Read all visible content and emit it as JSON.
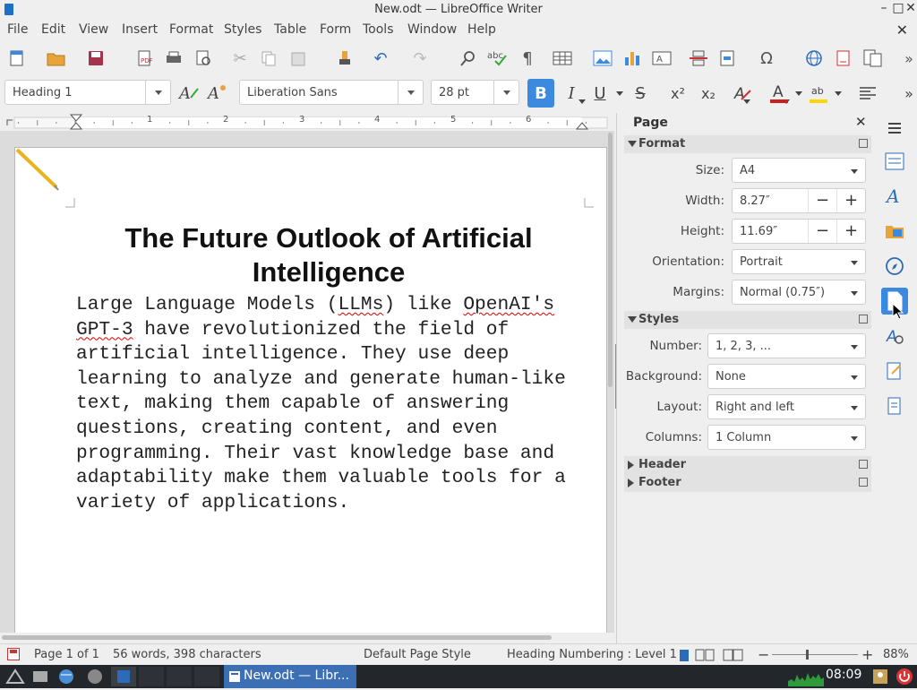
{
  "window": {
    "title": "New.odt — LibreOffice Writer"
  },
  "menu": [
    "File",
    "Edit",
    "View",
    "Insert",
    "Format",
    "Styles",
    "Table",
    "Form",
    "Tools",
    "Window",
    "Help"
  ],
  "format_bar": {
    "paragraph_style": "Heading 1",
    "font_name": "Liberation Sans",
    "font_size": "28 pt"
  },
  "document": {
    "heading": "The Future Outlook of Artificial Intelligence",
    "body": "Large Language Models (LLMs) like OpenAI's GPT-3 have revolutionized the field of artificial intelligence. They use deep learning to analyze and generate human-like text, making them capable of answering questions, creating content, and even programming. Their vast knowledge base and adaptability make them valuable tools for a variety of applications."
  },
  "ruler": {
    "marks": [
      "1",
      "2",
      "3",
      "4",
      "5",
      "6"
    ]
  },
  "sidebar": {
    "title": "Page",
    "format": {
      "header": "Format",
      "size_label": "Size:",
      "size_value": "A4",
      "width_label": "Width:",
      "width_value": "8.27″",
      "height_label": "Height:",
      "height_value": "11.69″",
      "orientation_label": "Orientation:",
      "orientation_value": "Portrait",
      "margins_label": "Margins:",
      "margins_value": "Normal (0.75″)"
    },
    "styles": {
      "header": "Styles",
      "number_label": "Number:",
      "number_value": "1, 2, 3, ...",
      "background_label": "Background:",
      "background_value": "None",
      "layout_label": "Layout:",
      "layout_value": "Right and left",
      "columns_label": "Columns:",
      "columns_value": "1 Column"
    },
    "header_section": "Header",
    "footer_section": "Footer"
  },
  "status": {
    "page": "Page 1 of 1",
    "words": "56 words, 398 characters",
    "page_style": "Default Page Style",
    "outline": "Heading Numbering : Level 1",
    "zoom": "88%"
  },
  "taskbar": {
    "task_label": "New.odt — Libr...",
    "clock": "08:09"
  },
  "colors": {
    "accent": "#3c8ae0",
    "font_color": "#c9211e",
    "highlight": "#ffd700"
  }
}
